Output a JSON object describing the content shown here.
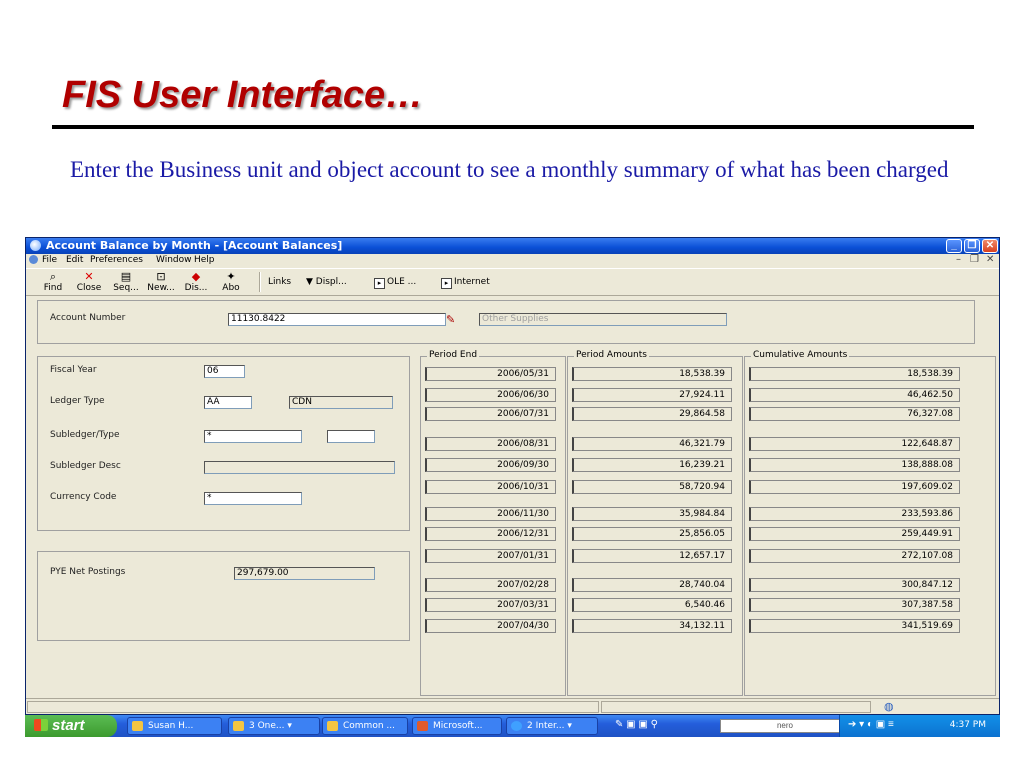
{
  "slide": {
    "title": "FIS User Interface…",
    "subtitle": "Enter the Business unit and object account to see a monthly summary of what has been charged"
  },
  "window": {
    "title": "Account Balance by Month - [Account Balances]",
    "menu": [
      "File",
      "Edit",
      "Preferences",
      "Window",
      "Help"
    ],
    "toolbar": {
      "tools": [
        {
          "label": "Find",
          "icon": "find-icon"
        },
        {
          "label": "Close",
          "icon": "close-icon"
        },
        {
          "label": "Seq...",
          "icon": "sequence-icon"
        },
        {
          "label": "New...",
          "icon": "new-icon"
        },
        {
          "label": "Dis...",
          "icon": "display-icon"
        },
        {
          "label": "Abo",
          "icon": "about-icon"
        }
      ],
      "links_label": "Links",
      "displ_label": "Displ...",
      "ole_label": "OLE ...",
      "internet_label": "Internet"
    },
    "header": {
      "account_number_label": "Account Number",
      "account_number_value": "11130.8422",
      "account_desc_placeholder": "Other Supplies"
    },
    "left": {
      "fiscal_year_label": "Fiscal Year",
      "fiscal_year_value": "06",
      "ledger_type_label": "Ledger Type",
      "ledger_type_value": "AA",
      "ledger_currency_value": "CDN",
      "subledger_type_label": "Subledger/Type",
      "subledger_value": "*",
      "subledger_type_value": "",
      "subledger_desc_label": "Subledger Desc",
      "subledger_desc_value": "",
      "currency_code_label": "Currency Code",
      "currency_code_value": "*",
      "pye_label": "PYE Net Postings",
      "pye_value": "297,679.00"
    },
    "grid": {
      "headers": [
        "Period End",
        "Period Amounts",
        "Cumulative Amounts"
      ],
      "rows": [
        [
          "2006/05/31",
          "18,538.39",
          "18,538.39"
        ],
        [
          "2006/06/30",
          "27,924.11",
          "46,462.50"
        ],
        [
          "2006/07/31",
          "29,864.58",
          "76,327.08"
        ],
        [
          "2006/08/31",
          "46,321.79",
          "122,648.87"
        ],
        [
          "2006/09/30",
          "16,239.21",
          "138,888.08"
        ],
        [
          "2006/10/31",
          "58,720.94",
          "197,609.02"
        ],
        [
          "2006/11/30",
          "35,984.84",
          "233,593.86"
        ],
        [
          "2006/12/31",
          "25,856.05",
          "259,449.91"
        ],
        [
          "2007/01/31",
          "12,657.17",
          "272,107.08"
        ],
        [
          "2007/02/28",
          "28,740.04",
          "300,847.12"
        ],
        [
          "2007/03/31",
          "6,540.46",
          "307,387.58"
        ],
        [
          "2007/04/30",
          "34,132.11",
          "341,519.69"
        ]
      ]
    }
  },
  "taskbar": {
    "start_label": "start",
    "tasks": [
      "Susan H...",
      "3 One...",
      "Common ...",
      "Microsoft...",
      "2 Inter..."
    ],
    "nero_label": "nero",
    "clock": "4:37 PM"
  }
}
